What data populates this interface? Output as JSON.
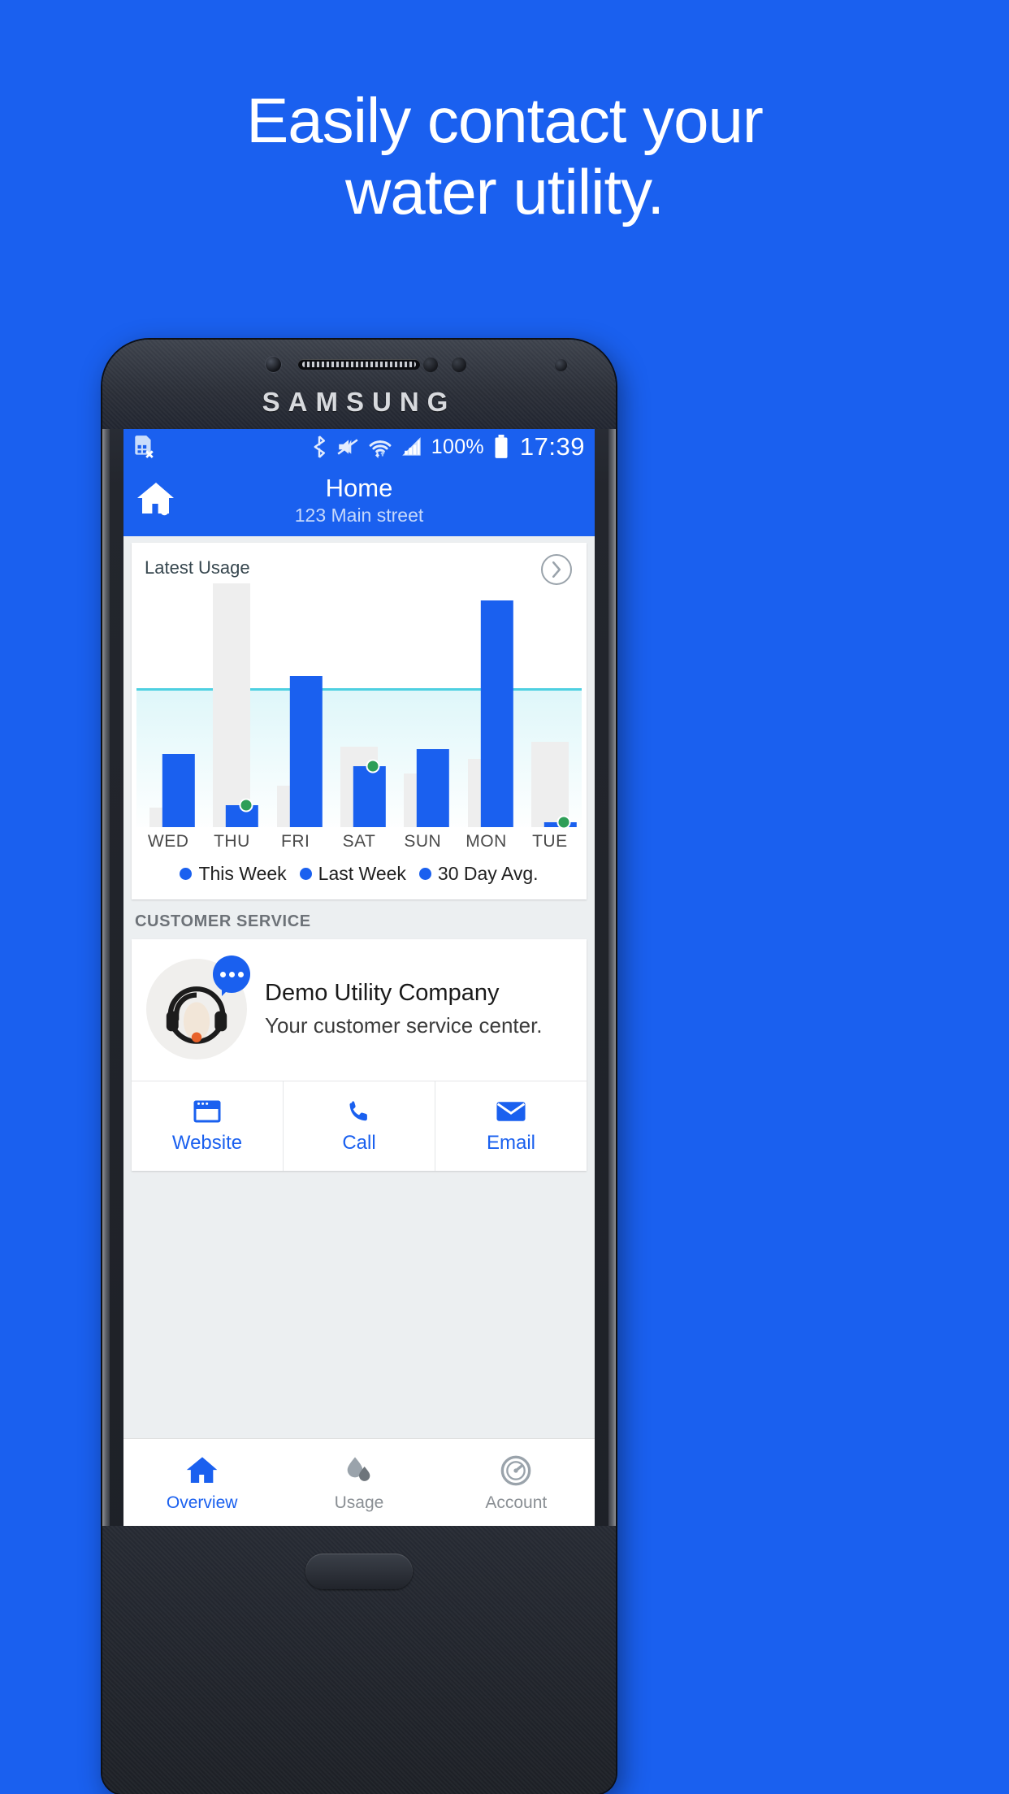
{
  "promo": {
    "headline_line1": "Easily contact your",
    "headline_line2": "water utility.",
    "background_color": "#1a60ef"
  },
  "device": {
    "brand": "SAMSUNG"
  },
  "statusbar": {
    "sim_icon": "sim-card-error-icon",
    "bluetooth_icon": "bluetooth-icon",
    "mute_icon": "mute-icon",
    "wifi_icon": "wifi-icon",
    "signal_icon": "cellular-signal-icon",
    "battery_percent": "100%",
    "battery_icon": "battery-full-icon",
    "time": "17:39"
  },
  "appbar": {
    "icon": "home-water-drop-icon",
    "title": "Home",
    "subtitle": "123 Main street"
  },
  "usage_card": {
    "title": "Latest Usage",
    "detail_icon": "chevron-right-circle-icon"
  },
  "chart_data": {
    "type": "bar",
    "title": "Latest Usage",
    "categories": [
      "WED",
      "THU",
      "FRI",
      "SAT",
      "SUN",
      "MON",
      "TUE"
    ],
    "series": [
      {
        "name": "This Week",
        "color": "#1a60ef",
        "values": [
          30,
          9,
          62,
          25,
          32,
          93,
          2
        ]
      },
      {
        "name": "30 Day Avg.",
        "color": "#eeeeee",
        "values": [
          8,
          100,
          17,
          33,
          22,
          28,
          35
        ]
      }
    ],
    "legend": [
      {
        "label": "This Week",
        "color": "#1a60ef"
      },
      {
        "label": "Last Week",
        "color": "#1a60ef"
      },
      {
        "label": "30 Day Avg.",
        "color": "#1a60ef"
      }
    ],
    "reference_line": {
      "label": "average",
      "value": 56,
      "color": "#4dd0e1"
    },
    "markers": {
      "color": "#2e9e57",
      "on": [
        "THU",
        "SAT",
        "TUE"
      ]
    },
    "ylim": [
      0,
      100
    ],
    "grid": false,
    "legend_position": "bottom",
    "xlabel": "",
    "ylabel": ""
  },
  "customer_service": {
    "section_label": "CUSTOMER SERVICE",
    "avatar_icon": "headset-agent-icon",
    "badge_icon": "chat-bubble-icon",
    "company_name": "Demo Utility Company",
    "company_desc": "Your customer service center.",
    "actions": [
      {
        "label": "Website",
        "icon": "browser-window-icon"
      },
      {
        "label": "Call",
        "icon": "phone-icon"
      },
      {
        "label": "Email",
        "icon": "envelope-icon"
      }
    ]
  },
  "bottom_nav": {
    "active": "Overview",
    "items": [
      {
        "label": "Overview",
        "icon": "home-icon"
      },
      {
        "label": "Usage",
        "icon": "water-drops-icon"
      },
      {
        "label": "Account",
        "icon": "gauge-icon"
      }
    ]
  }
}
